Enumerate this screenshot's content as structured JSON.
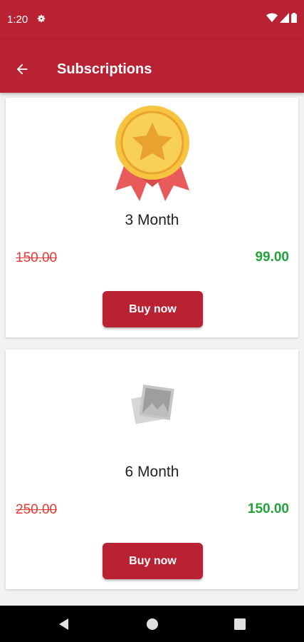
{
  "status": {
    "time": "1:20"
  },
  "appbar": {
    "title": "Subscriptions"
  },
  "plans": [
    {
      "name": "3 Month",
      "old_price": "150.00",
      "new_price": "99.00",
      "button": "Buy now",
      "icon": "medal-star-icon"
    },
    {
      "name": "6 Month",
      "old_price": "250.00",
      "new_price": "150.00",
      "button": "Buy now",
      "icon": "image-placeholder-icon"
    }
  ],
  "colors": {
    "primary": "#b82233",
    "old_price": "#e53935",
    "new_price": "#21a339"
  }
}
